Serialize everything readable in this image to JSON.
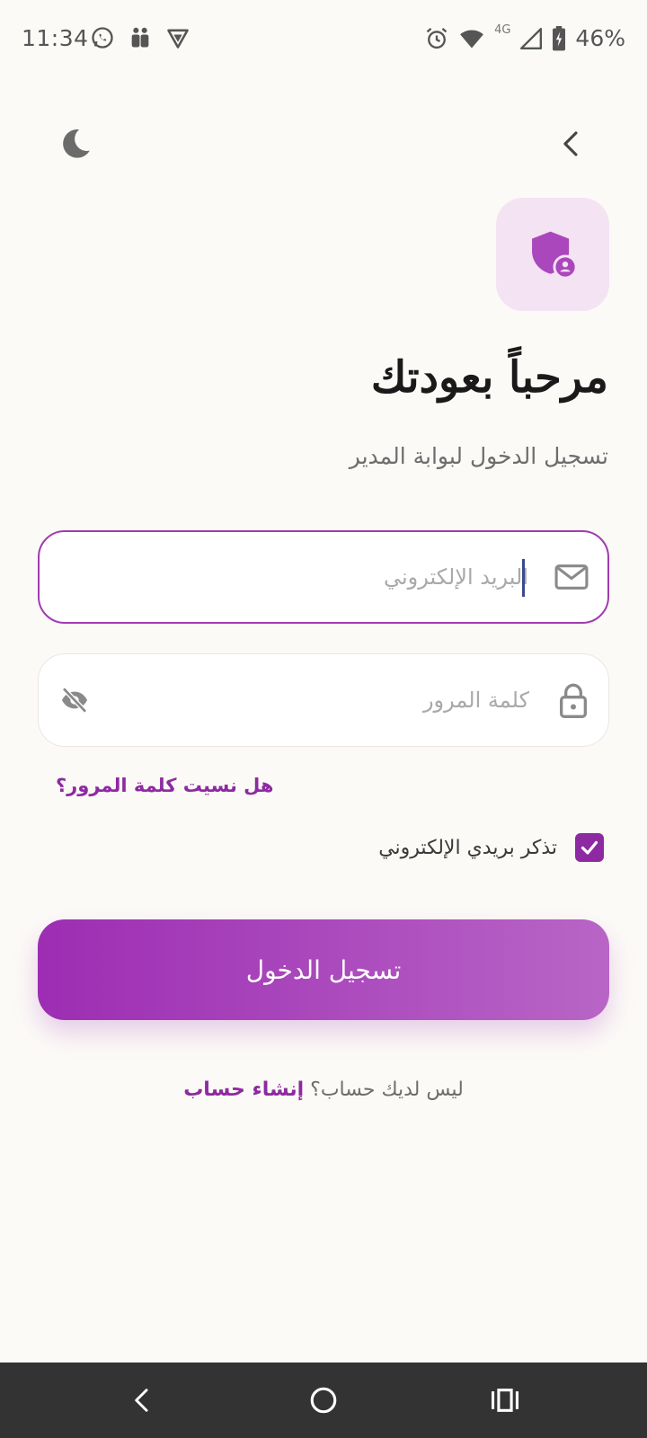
{
  "status_bar": {
    "time": "11:34",
    "battery": "46%",
    "network": "4G",
    "icons": [
      "whatsapp-icon",
      "teams-icon",
      "vpn-icon",
      "alarm-icon",
      "wifi-icon",
      "signal-icon",
      "battery-charging-icon"
    ]
  },
  "header": {
    "theme_toggle_icon": "moon-icon",
    "back_icon": "chevron-left-icon"
  },
  "hero": {
    "icon": "shield-user-icon"
  },
  "title": "مرحباً بعودتك",
  "subtitle": "تسجيل الدخول لبوابة المدير",
  "form": {
    "email": {
      "placeholder": "البريد الإلكتروني",
      "value": "",
      "icon": "mail-icon"
    },
    "password": {
      "placeholder": "كلمة المرور",
      "value": "",
      "icon": "lock-icon",
      "toggle_icon": "eye-off-icon"
    },
    "forgot_password": "هل نسيت كلمة المرور؟",
    "remember_email": {
      "label": "تذكر بريدي الإلكتروني",
      "checked": true
    },
    "submit_label": "تسجيل الدخول"
  },
  "signup": {
    "prompt": "ليس لديك حساب؟ ",
    "link": "إنشاء حساب"
  },
  "colors": {
    "accent": "#8e2aa1",
    "button_gradient_start": "#9d2db3",
    "button_gradient_end": "#b865c6",
    "icon_tile": "#f3e3f3",
    "background": "#fcfaf7"
  },
  "nav_bar": {
    "icons": [
      "nav-back-icon",
      "nav-home-icon",
      "nav-recents-icon"
    ]
  }
}
